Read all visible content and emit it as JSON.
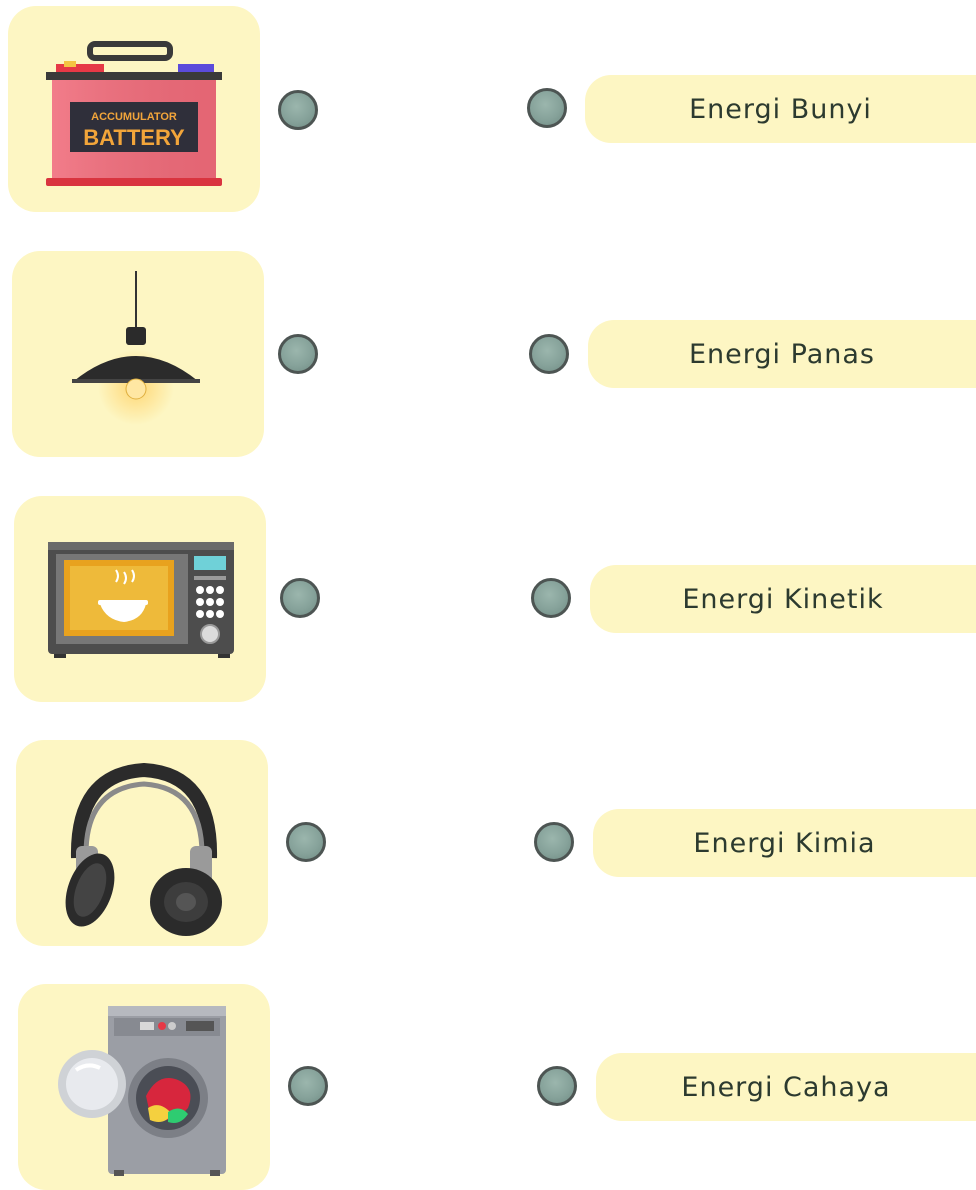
{
  "items": [
    {
      "name": "Accumulator battery",
      "icon": "battery-icon",
      "label_top": "ACCUMULATOR",
      "label_bottom": "BATTERY"
    },
    {
      "name": "Pendant lamp",
      "icon": "lamp-icon"
    },
    {
      "name": "Microwave",
      "icon": "microwave-icon"
    },
    {
      "name": "Headphones",
      "icon": "headphones-icon"
    },
    {
      "name": "Washing machine",
      "icon": "washing-machine-icon"
    }
  ],
  "answers": [
    {
      "label": "Energi Bunyi"
    },
    {
      "label": "Energi Panas"
    },
    {
      "label": "Energi Kinetik"
    },
    {
      "label": "Energi Kimia"
    },
    {
      "label": "Energi Cahaya"
    }
  ],
  "colors": {
    "card_bg": "#fdf6c3",
    "dot_fill": "#86a29a",
    "dot_border": "#4d5553",
    "text": "#2c3a2f"
  }
}
